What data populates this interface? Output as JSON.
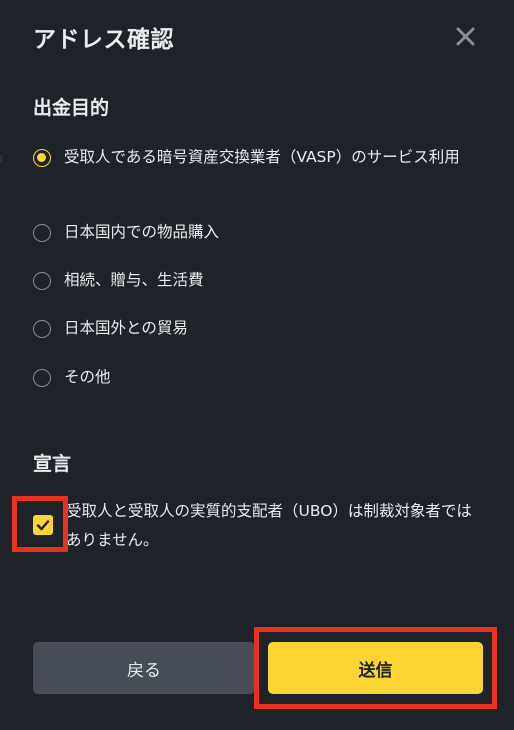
{
  "dialog": {
    "title": "アドレス確認",
    "close_icon": "close-icon"
  },
  "purpose": {
    "heading": "出金目的",
    "options": [
      {
        "label": "受取人である暗号資産交換業者（VASP）のサービス利用",
        "selected": true
      },
      {
        "label": "日本国内での物品購入",
        "selected": false
      },
      {
        "label": "相続、贈与、生活費",
        "selected": false
      },
      {
        "label": "日本国外との貿易",
        "selected": false
      },
      {
        "label": "その他",
        "selected": false
      }
    ]
  },
  "declaration": {
    "heading": "宣言",
    "text": "受取人と受取人の実質的支配者（UBO）は制裁対象者ではありません。",
    "checked": true
  },
  "footer": {
    "back_label": "戻る",
    "submit_label": "送信"
  },
  "colors": {
    "background": "#1e2329",
    "accent": "#fcd535",
    "highlight": "#e8321e",
    "secondary_button": "#474d57"
  }
}
